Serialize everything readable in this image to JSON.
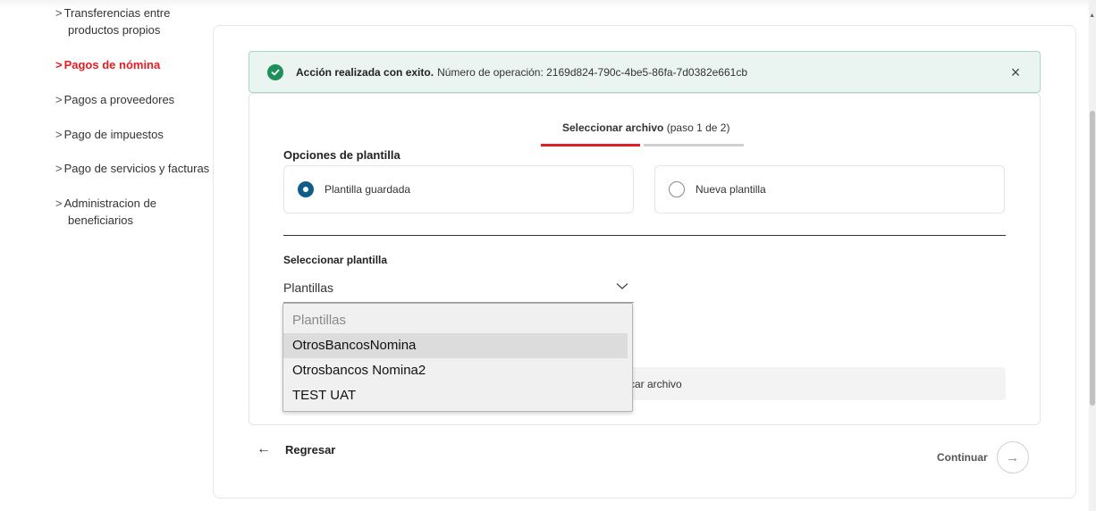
{
  "sidebar": {
    "items": [
      {
        "label_line1": "Transferencias entre",
        "label_line2": "productos propios",
        "active": false
      },
      {
        "label": "Pagos de nómina",
        "active": true
      },
      {
        "label": "Pagos a proveedores",
        "active": false
      },
      {
        "label": "Pago de impuestos",
        "active": false
      },
      {
        "label": "Pago de servicios y facturas",
        "active": false
      },
      {
        "label_line1": "Administracion de",
        "label_line2": "beneficiarios",
        "active": false
      }
    ]
  },
  "alert": {
    "strong": "Acción realizada con exito.",
    "text": "Número de operación: 2169d824-790c-4be5-86fa-7d0382e661cb",
    "close": "×"
  },
  "stepper": {
    "title": "Seleccionar archivo",
    "step_text": "(paso 1 de 2)"
  },
  "template_options": {
    "label": "Opciones de plantilla",
    "saved": "Plantilla guardada",
    "new": "Nueva plantilla"
  },
  "select": {
    "label": "Seleccionar plantilla",
    "value": "Plantillas",
    "options": [
      "Plantillas",
      "OtrosBancosNomina",
      "Otrosbancos Nomina2",
      "TEST UAT"
    ]
  },
  "upload": {
    "label": "Buscar archivo",
    "visible_text": "car archivo"
  },
  "footer": {
    "back_arrow": "←",
    "back": "Regresar",
    "continue": "Continuar",
    "continue_arrow": "→"
  },
  "colors": {
    "accent_red": "#e41c23",
    "success_green": "#1e8f5a",
    "radio_blue": "#0f5e8a",
    "alert_bg": "#eaf5f1"
  }
}
